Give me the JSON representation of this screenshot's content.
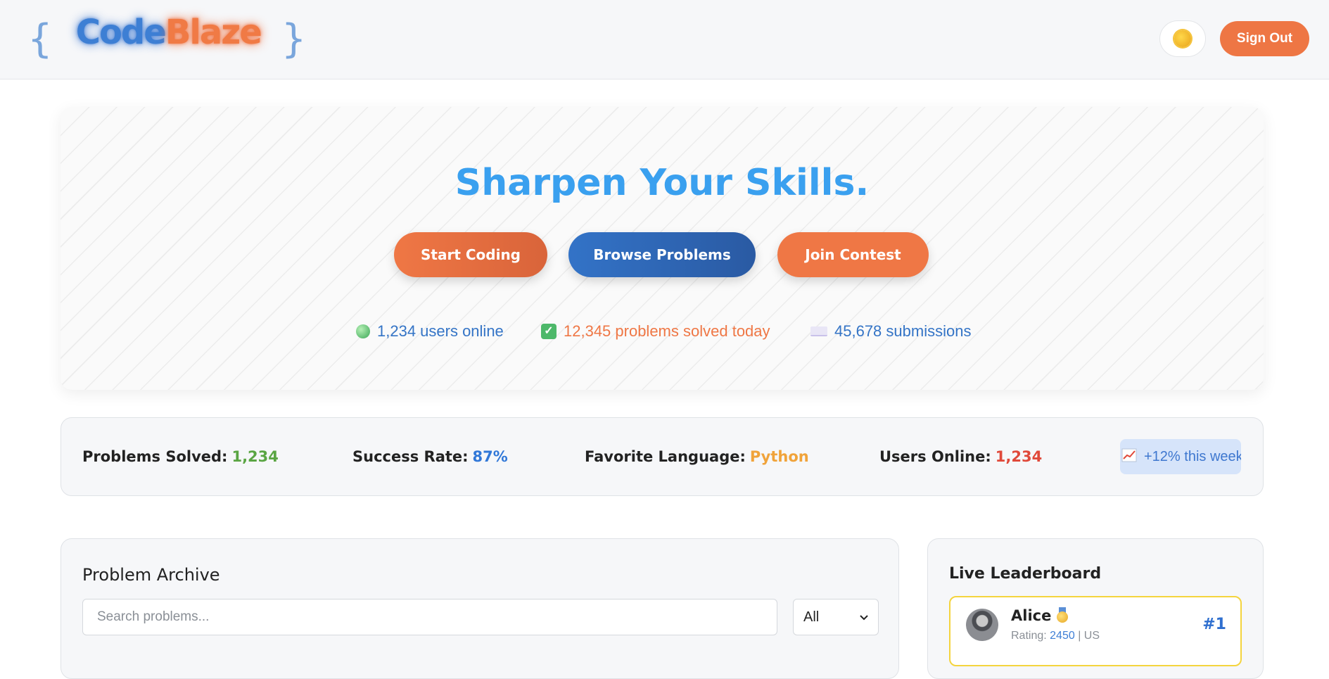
{
  "header": {
    "logo": {
      "brace_open": "{",
      "code": "Code",
      "blaze": "Blaze",
      "brace_close": "}"
    },
    "theme_icon": "sun-icon",
    "sign_out_label": "Sign Out"
  },
  "hero": {
    "title": "Sharpen Your Skills.",
    "buttons": {
      "start": "Start Coding",
      "browse": "Browse Problems",
      "contest": "Join Contest"
    },
    "stats": {
      "online": "1,234 users online",
      "solved": "12,345 problems solved today",
      "submissions": "45,678 submissions"
    }
  },
  "stats_bar": {
    "items": [
      {
        "label": "Problems Solved:",
        "value": "1,234"
      },
      {
        "label": "Success Rate:",
        "value": "87%"
      },
      {
        "label": "Favorite Language:",
        "value": "Python"
      },
      {
        "label": "Users Online:",
        "value": "1,234"
      }
    ],
    "trend": "+12% this week"
  },
  "archive": {
    "title": "Problem Archive",
    "search_placeholder": "Search problems...",
    "filter_selected": "All"
  },
  "leaderboard": {
    "title": "Live Leaderboard",
    "entries": [
      {
        "name": "Alice",
        "rating_label": "Rating:",
        "rating_value": "2450",
        "suffix": "| US",
        "rank": "#1"
      }
    ]
  },
  "colors": {
    "accent_orange": "#ee7644",
    "accent_blue": "#3373c7",
    "title_blue": "#3aa0ef",
    "green": "#5aa543",
    "red": "#e0493a",
    "amber": "#f0a33a"
  }
}
